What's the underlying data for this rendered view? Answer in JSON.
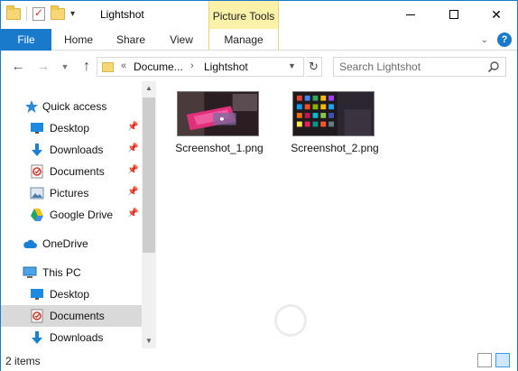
{
  "window": {
    "title": "Lightshot",
    "contextual_tab": "Picture Tools"
  },
  "ribbon": {
    "tabs": [
      "File",
      "Home",
      "Share",
      "View",
      "Manage"
    ]
  },
  "address": {
    "overflow": "«",
    "segments": [
      "Docume...",
      "Lightshot"
    ]
  },
  "search": {
    "placeholder": "Search Lightshot"
  },
  "navigation": {
    "items": [
      {
        "label": "Quick access",
        "icon": "star-icon"
      },
      {
        "label": "Desktop",
        "icon": "desktop-icon",
        "pinned": true
      },
      {
        "label": "Downloads",
        "icon": "download-arrow-icon",
        "pinned": true
      },
      {
        "label": "Documents",
        "icon": "documents-icon",
        "pinned": true
      },
      {
        "label": "Pictures",
        "icon": "pictures-icon",
        "pinned": true
      },
      {
        "label": "Google Drive",
        "icon": "google-drive-icon",
        "pinned": true
      },
      {
        "label": "OneDrive",
        "icon": "cloud-icon"
      },
      {
        "label": "This PC",
        "icon": "computer-icon"
      },
      {
        "label": "Desktop",
        "icon": "desktop-icon"
      },
      {
        "label": "Documents",
        "icon": "documents-icon",
        "selected": true
      },
      {
        "label": "Downloads",
        "icon": "download-arrow-icon"
      }
    ]
  },
  "files": [
    {
      "name": "Screenshot_1.png",
      "thumbnail": "pink-keyboard-photo"
    },
    {
      "name": "Screenshot_2.png",
      "thumbnail": "phone-apps-photo"
    }
  ],
  "status": {
    "item_count": "2 items"
  },
  "colors": {
    "accent": "#1979ca",
    "contextual_tab": "#fcf1a8",
    "selected_nav": "#d9d9d9"
  }
}
